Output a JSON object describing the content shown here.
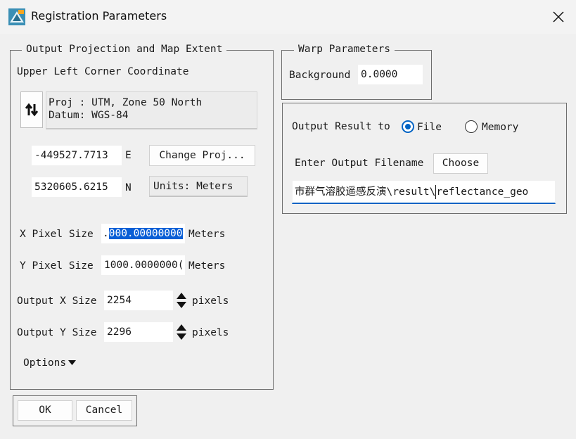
{
  "window": {
    "title": "Registration Parameters"
  },
  "output_group": {
    "legend": "Output Projection and Map Extent",
    "corner_label": "Upper Left Corner Coordinate",
    "proj_line": "Proj : UTM, Zone 50 North",
    "datum_line": "Datum: WGS-84",
    "easting_value": "-449527.7713",
    "easting_unit": "E",
    "change_proj_label": "Change Proj...",
    "northing_value": "5320605.6215",
    "northing_unit": "N",
    "units_label": "Units: Meters",
    "x_pixel_label": "X Pixel Size",
    "x_pixel_prefix": ".",
    "x_pixel_selected": "000.00000000",
    "x_pixel_unit": "Meters",
    "y_pixel_label": "Y Pixel Size",
    "y_pixel_value": "1000.0000000(",
    "y_pixel_unit": "Meters",
    "out_x_label": "Output X Size",
    "out_x_value": "2254",
    "out_x_unit": "pixels",
    "out_y_label": "Output Y Size",
    "out_y_value": "2296",
    "out_y_unit": "pixels",
    "options_label": "Options"
  },
  "warp_group": {
    "legend": "Warp Parameters",
    "background_label": "Background",
    "background_value": "0.0000"
  },
  "result_group": {
    "output_to_label": "Output Result to",
    "file_label": "File",
    "memory_label": "Memory",
    "selected": "File",
    "filename_label": "Enter Output Filename",
    "choose_label": "Choose",
    "filename_before_cursor": "市群气溶胶遥感反演\\result\\",
    "filename_after_cursor": "reflectance_geo"
  },
  "buttons": {
    "ok": "OK",
    "cancel": "Cancel"
  },
  "colors": {
    "accent": "#0063c4",
    "selection": "#0a5fd6"
  },
  "icons": {
    "app": "envi-globe-icon",
    "close": "close-icon",
    "swap": "swap-arrows-icon",
    "spin": "spinner-arrows-icon",
    "options": "caret-down-icon"
  }
}
